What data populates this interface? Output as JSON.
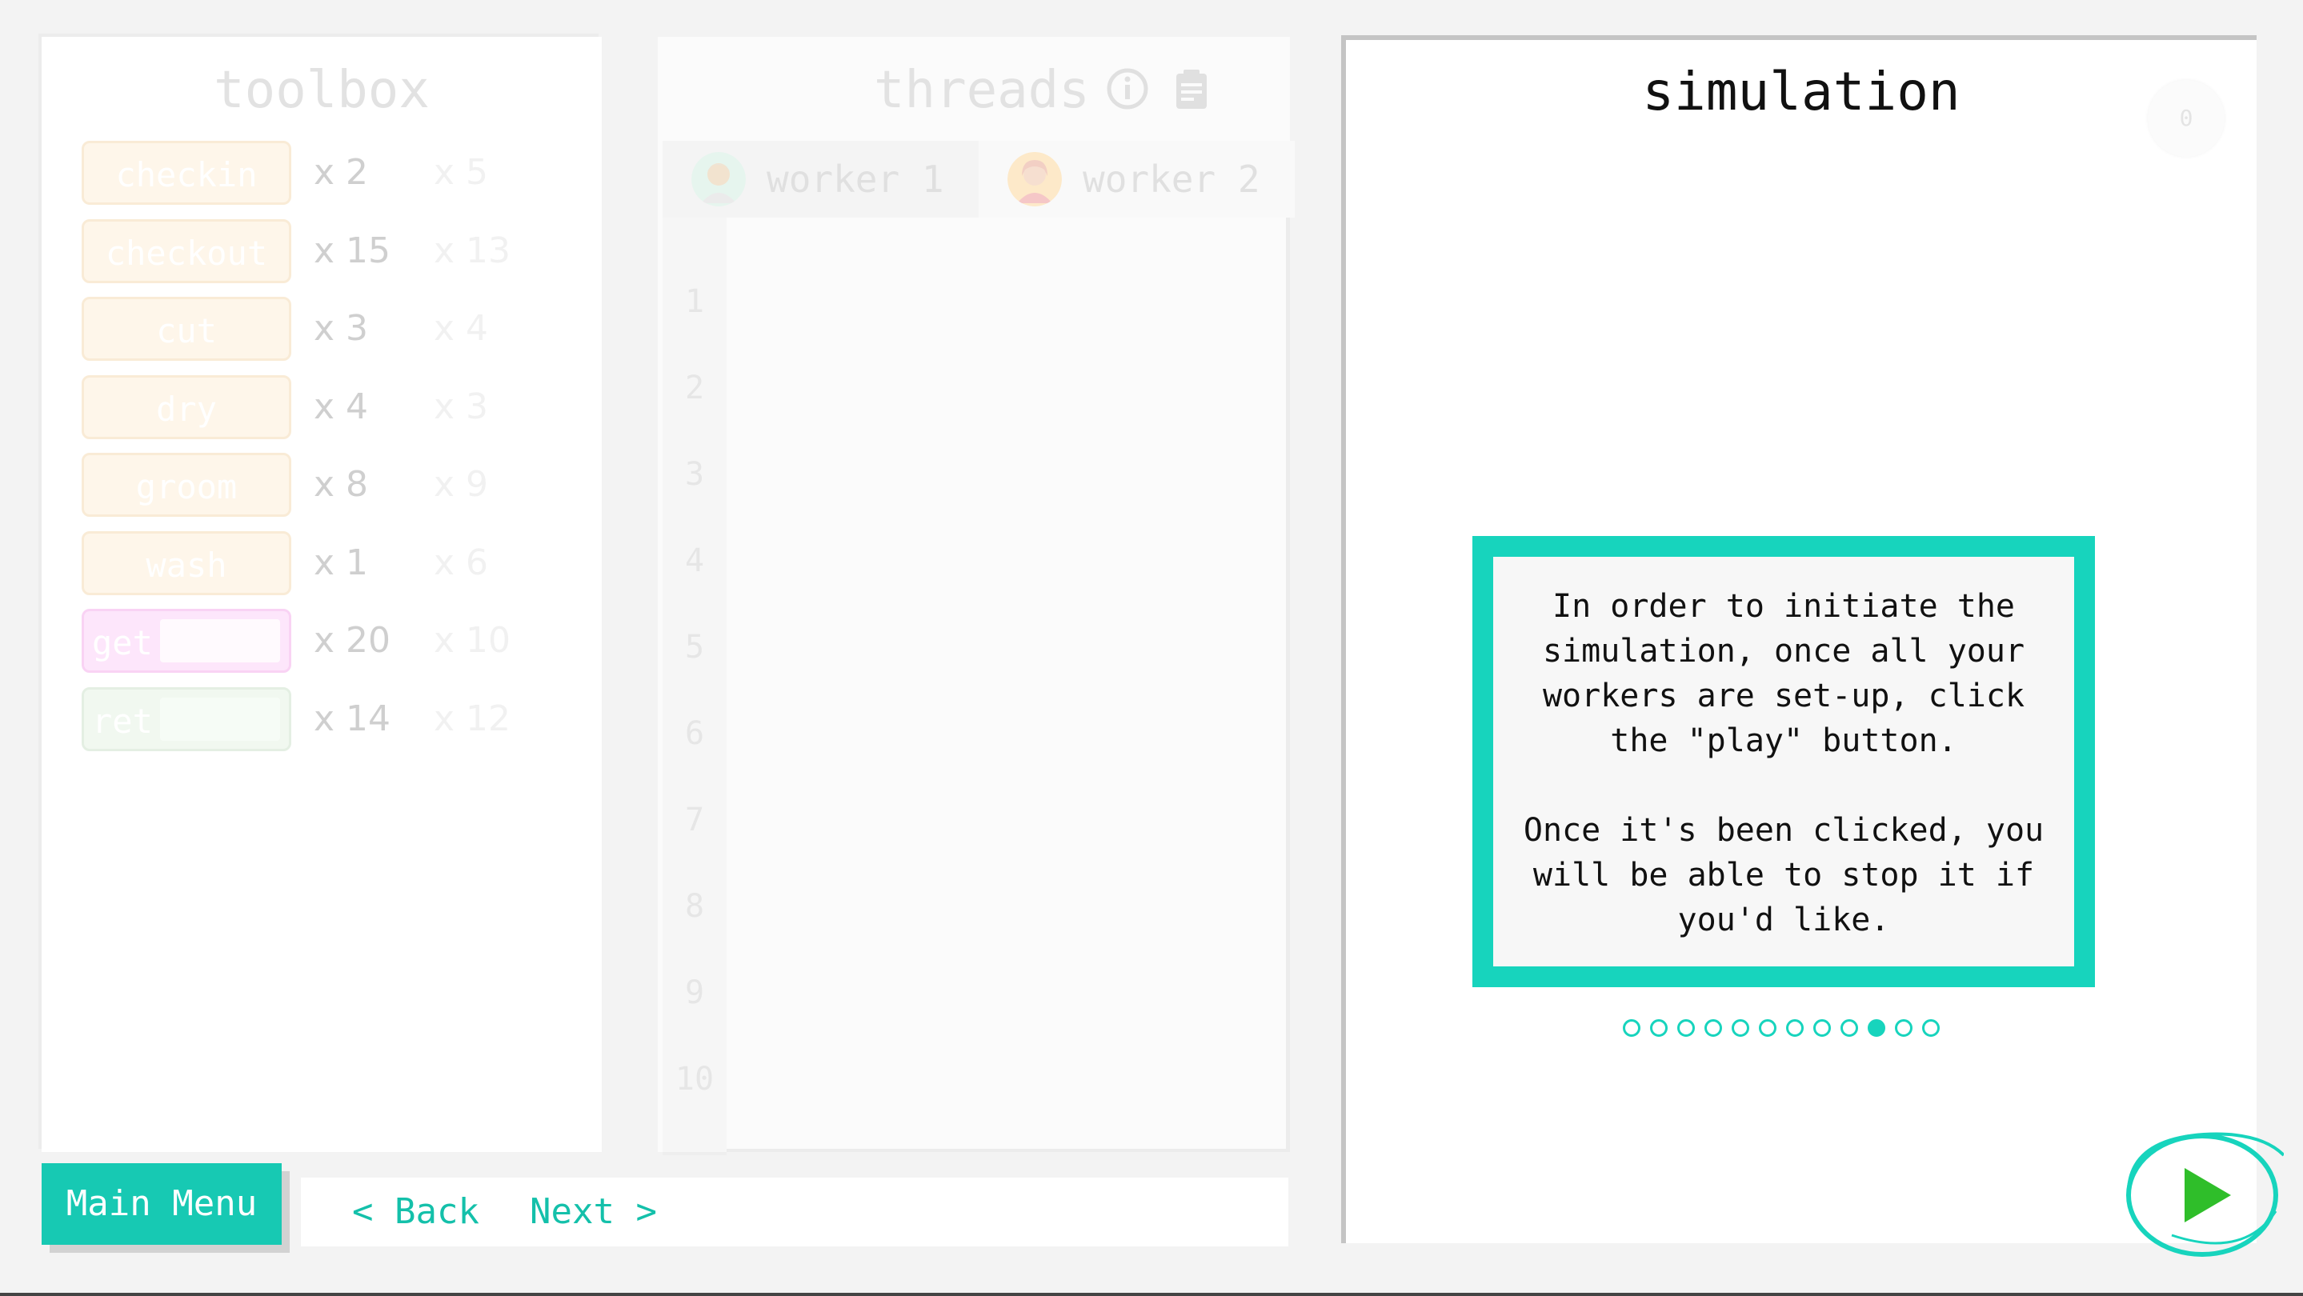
{
  "colors": {
    "accent": "#17d4bd",
    "play": "#2fbe2a"
  },
  "toolbox": {
    "title": "toolbox",
    "tools": [
      {
        "name": "checkin",
        "qty": "x 2",
        "qty2": "x 5",
        "kind": "orange"
      },
      {
        "name": "checkout",
        "qty": "x 15",
        "qty2": "x 13",
        "kind": "orange"
      },
      {
        "name": "cut",
        "qty": "x 3",
        "qty2": "x 4",
        "kind": "orange"
      },
      {
        "name": "dry",
        "qty": "x 4",
        "qty2": "x 3",
        "kind": "orange"
      },
      {
        "name": "groom",
        "qty": "x 8",
        "qty2": "x 9",
        "kind": "orange"
      },
      {
        "name": "wash",
        "qty": "x 1",
        "qty2": "x 6",
        "kind": "orange"
      },
      {
        "name": "get",
        "qty": "x 20",
        "qty2": "x 10",
        "kind": "pink"
      },
      {
        "name": "ret",
        "qty": "x 14",
        "qty2": "x 12",
        "kind": "green"
      }
    ]
  },
  "threads": {
    "title": "threads",
    "tabs": [
      {
        "label": "worker 1"
      },
      {
        "label": "worker 2"
      }
    ],
    "line_numbers": [
      "1",
      "2",
      "3",
      "4",
      "5",
      "6",
      "7",
      "8",
      "9",
      "10"
    ]
  },
  "simulation": {
    "title": "simulation",
    "counter": "0",
    "tip_paragraphs": [
      "In order to initiate the simulation, once all your workers are set-up, click the \"play\" button.",
      "Once it's been clicked, you will be able to stop it if you'd like."
    ],
    "tip_step": 10,
    "tip_total": 12
  },
  "footer": {
    "main_menu": "Main Menu",
    "back": "< Back",
    "next": "Next >"
  }
}
